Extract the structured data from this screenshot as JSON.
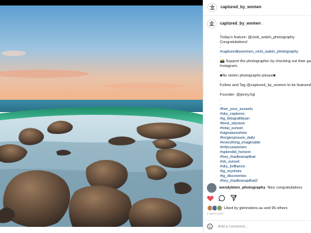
{
  "post": {
    "username": "captured_by_women"
  },
  "caption": {
    "username": "captured_by_women",
    "dot": ".",
    "lines": [
      {
        "text": ".",
        "link": false
      },
      {
        "text": "Today's feature: @vicki_walsh_photography",
        "link": false
      },
      {
        "text": "Congratulations!",
        "link": false
      },
      {
        "text": ".",
        "link": false
      },
      {
        "text": "#capturedbywomen_vicki_walsh_photography",
        "link": true
      },
      {
        "text": ".",
        "link": false
      },
      {
        "text": "📸 Support the photographer by checking out their gallery on",
        "link": false
      },
      {
        "text": "Instagram.",
        "link": false
      },
      {
        "text": ".",
        "link": false
      },
      {
        "text": "■No stolen photographs please■",
        "link": false
      },
      {
        "text": ".",
        "link": false
      },
      {
        "text": "Follow and Tag @captured_by_women to be featured.",
        "link": false
      },
      {
        "text": ".",
        "link": false
      },
      {
        "text": "Founder: @jenny.fuji",
        "link": false
      },
      {
        "text": ".",
        "link": false
      },
      {
        "text": ".",
        "link": false
      }
    ],
    "hashtags": [
      "#live_your_sunsets",
      "#sky_captures",
      "#ig_fotografdiyari",
      "#best_skyview",
      "#total_sunset",
      "#signatureshots",
      "#longexposure_daily",
      "#everything_imaginable",
      "#infocuswomen",
      "#splendid_horizon",
      "#hey_ihadtosnapthat",
      "#ok_sunset",
      "#sky_brilliance",
      "#ig_myshots",
      "#ig_discoveries",
      "#hey_ihadtosnapthat2"
    ]
  },
  "comment": {
    "username": "wendyklein_photography",
    "text": "Nice congratulations"
  },
  "actions": {
    "like_icon": "heart-filled-icon",
    "comment_icon": "comment-icon",
    "share_icon": "send-icon",
    "like_color": "#ed4956"
  },
  "likes": {
    "text": "Liked by glennslens.au and 96 others"
  },
  "time_ago": "3 DAYS AGO",
  "add_comment": {
    "placeholder": "Add a comment..."
  }
}
